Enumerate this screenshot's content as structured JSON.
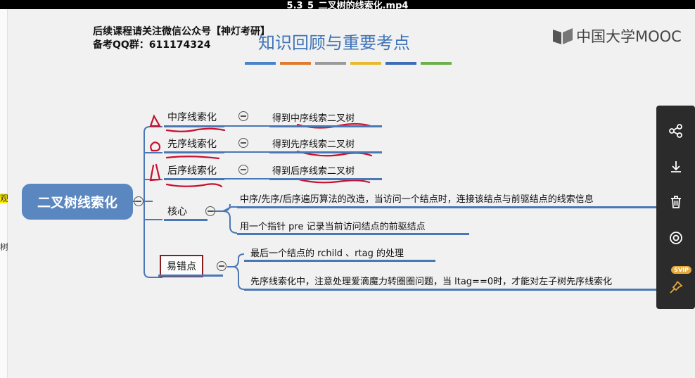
{
  "window": {
    "title": "5.3_5_二叉树的线索化.mp4"
  },
  "left_strip": {
    "glyph_top": "观",
    "glyph_bottom": "树"
  },
  "watermark": {
    "line1": "后续课程请关注微信公众号【神灯考研】",
    "line2": "备考QQ群：611174324"
  },
  "slide": {
    "title": "知识回顾与重要考点",
    "color_bars": [
      "#4a83c8",
      "#e07a2e",
      "#9a9a9a",
      "#e8b92e",
      "#3e6db5",
      "#6ab04c"
    ]
  },
  "brand": {
    "name": "中国大学MOOC",
    "icon": "mooc-logo-icon"
  },
  "mindmap": {
    "root": "二叉树线索化",
    "branches": [
      {
        "label": "中序线索化",
        "leaf": "得到中序线索二叉树"
      },
      {
        "label": "先序线索化",
        "leaf": "得到先序线索二叉树"
      },
      {
        "label": "后序线索化",
        "leaf": "得到后序线索二叉树"
      }
    ],
    "core": {
      "label": "核心",
      "items": [
        "中序/先序/后序遍历算法的改造，当访问一个结点时，连接该结点与前驱结点的线索信息",
        "用一个指针 pre 记录当前访问结点的前驱结点"
      ]
    },
    "pitfalls": {
      "label": "易错点",
      "items": [
        "最后一个结点的 rchild 、rtag 的处理",
        "先序线索化中，注意处理爱滴魔力转圈圈问题，当 ltag==0时，才能对左子树先序线索化"
      ]
    }
  },
  "toolbar": {
    "items": [
      {
        "name": "share-icon"
      },
      {
        "name": "download-icon"
      },
      {
        "name": "trash-icon"
      },
      {
        "name": "view-icon"
      },
      {
        "name": "pin-icon"
      }
    ],
    "badge": "SVIP"
  }
}
